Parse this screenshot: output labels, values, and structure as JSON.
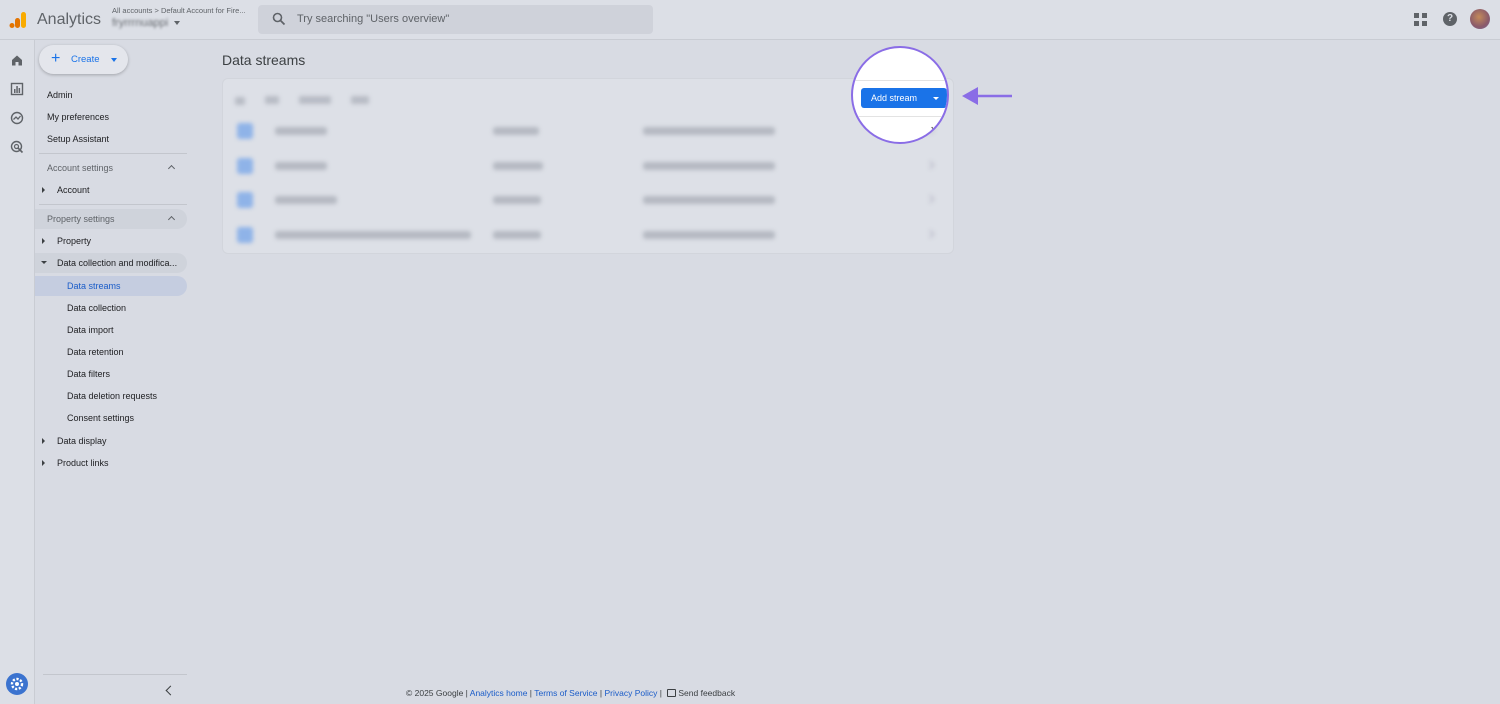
{
  "header": {
    "app_title": "Analytics",
    "account_path": "All accounts > Default Account for Fire...",
    "account_name": "fryrrrnuappi",
    "search_placeholder": "Try searching \"Users overview\""
  },
  "nav": {
    "create_label": "Create",
    "items": [
      "Admin",
      "My preferences",
      "Setup Assistant"
    ],
    "account_settings": {
      "label": "Account settings",
      "items": [
        "Account"
      ]
    },
    "property_settings": {
      "label": "Property settings",
      "items": [
        "Property",
        "Data collection and modifica...",
        "Data display",
        "Product links"
      ],
      "sub_items": [
        "Data streams",
        "Data collection",
        "Data import",
        "Data retention",
        "Data filters",
        "Data deletion requests",
        "Consent settings"
      ],
      "active": "Data streams"
    }
  },
  "main": {
    "title": "Data streams",
    "add_stream_label": "Add stream"
  },
  "footer": {
    "copyright": "© 2025 Google |",
    "analytics_home": "Analytics home",
    "terms": "Terms of Service",
    "privacy": "Privacy Policy",
    "sep": "|",
    "feedback": "Send feedback"
  },
  "colors": {
    "accent": "#1a73e8",
    "highlight": "#8a6de6"
  }
}
